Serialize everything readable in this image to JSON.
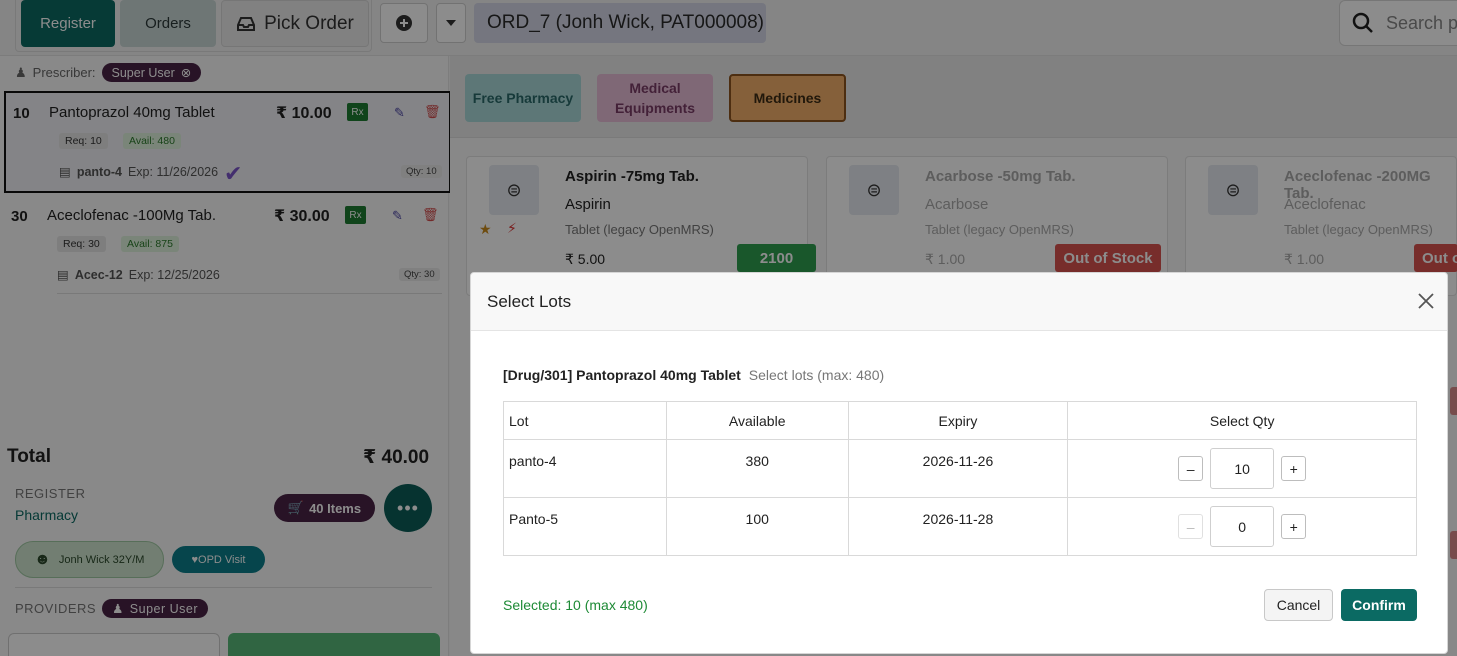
{
  "topbar": {
    "register_label": "Register",
    "orders_label": "Orders",
    "pick_order_label": "Pick Order",
    "order_chip": "ORD_7 (Jonh Wick, PAT000008)",
    "search_placeholder": "Search p"
  },
  "left": {
    "prescriber_label": "Prescriber:",
    "prescriber_name": "Super User",
    "items": [
      {
        "qty": "10",
        "name": "Pantoprazol 40mg Tablet",
        "price": "₹ 10.00",
        "rx": "Rx",
        "req": "Req: 10",
        "avail": "Avail: 480",
        "lot": "panto-4",
        "exp": "Exp: 11/26/2026",
        "qty_tag": "Qty: 10"
      },
      {
        "qty": "30",
        "name": "Aceclofenac -100Mg Tab.",
        "price": "₹ 30.00",
        "rx": "Rx",
        "req": "Req: 30",
        "avail": "Avail: 875",
        "lot": "Acec-12",
        "exp": "Exp: 12/25/2026",
        "qty_tag": "Qty: 30"
      }
    ],
    "total_label": "Total",
    "total_value": "₹ 40.00",
    "register_label": "REGISTER",
    "register_sub": "Pharmacy",
    "items_pill": "40 Items",
    "patient": "Jonh Wick 32Y/M",
    "visit": "OPD Visit",
    "providers_label": "PROVIDERS",
    "provider_name": "Super User"
  },
  "right": {
    "categories": [
      "Free Pharmacy",
      "Medical Equipments",
      "Medicines"
    ],
    "cards": [
      {
        "title": "Aspirin -75mg Tab.",
        "generic": "Aspirin",
        "form": "Tablet (legacy OpenMRS)",
        "price": "₹ 5.00",
        "stock": "2100"
      },
      {
        "title": "Acarbose -50mg Tab.",
        "generic": "Acarbose",
        "form": "Tablet (legacy OpenMRS)",
        "price": "₹ 1.00",
        "stock": "Out of Stock"
      },
      {
        "title": "Aceclofenac -200MG Tab.",
        "generic": "Aceclofenac",
        "form": "Tablet (legacy OpenMRS)",
        "price": "₹ 1.00",
        "stock": "Out o"
      }
    ]
  },
  "modal": {
    "title": "Select Lots",
    "drug_name": "[Drug/301] Pantoprazol 40mg Tablet",
    "drug_hint": "Select lots (max: 480)",
    "columns": [
      "Lot",
      "Available",
      "Expiry",
      "Select Qty"
    ],
    "rows": [
      {
        "lot": "panto-4",
        "available": "380",
        "expiry": "2026-11-26",
        "qty": "10"
      },
      {
        "lot": "Panto-5",
        "available": "100",
        "expiry": "2026-11-28",
        "qty": "0"
      }
    ],
    "summary": "Selected: 10 (max 480)",
    "cancel_label": "Cancel",
    "confirm_label": "Confirm"
  },
  "colors": {
    "accent": "#0b6a63",
    "success_text": "#1d8a35",
    "stock_ok": "#2e9e4f",
    "stock_out": "#d9534f"
  }
}
